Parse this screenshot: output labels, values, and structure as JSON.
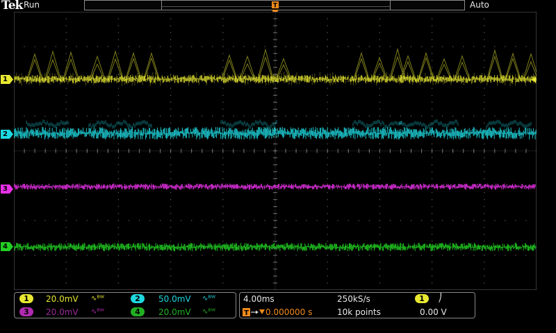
{
  "header": {
    "brand": "Tek",
    "run_state": "Run",
    "trigger_mode": "Auto",
    "trigger_badge": "T"
  },
  "colors": {
    "ch1": "#e8e832",
    "ch2": "#1ed8e0",
    "ch3": "#e830e8",
    "ch4": "#22d022",
    "trigger": "#f08a1a",
    "grid": "#555555"
  },
  "channel_markers": {
    "ch1": "1",
    "ch2": "2",
    "ch3": "3",
    "ch4": "4"
  },
  "channels": [
    {
      "id": "1",
      "scale": "20.0mV",
      "bw": "∿ᴮᵂ"
    },
    {
      "id": "2",
      "scale": "50.0mV",
      "bw": "∿ᴮᵂ"
    },
    {
      "id": "3",
      "scale": "20.0mV",
      "bw": "∿ᴮᵂ"
    },
    {
      "id": "4",
      "scale": "20.0mV",
      "bw": "∿ᴮᵂ"
    }
  ],
  "timebase": {
    "horizontal_scale": "4.00ms",
    "sample_rate": "250kS/s",
    "trigger_position": "0.000000 s",
    "record_length": "10k points",
    "trigger_source": "1",
    "trigger_slope": "⎠",
    "trigger_level": "0.00 V"
  }
}
